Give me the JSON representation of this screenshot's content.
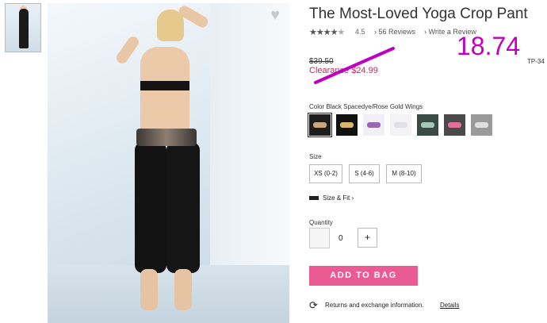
{
  "product": {
    "title": "The Most-Loved Yoga Crop Pant",
    "rating_value": "4.5",
    "reviews_label": "56 Reviews",
    "write_review_label": "Write a Review",
    "original_price": "$39.50",
    "clearance_price": "Clearance $24.99",
    "sku": "TP-34"
  },
  "annotation": {
    "price_text": "18.74",
    "color": "#c000c0"
  },
  "color": {
    "label": "Color Black Spacedye/Rose Gold Wings",
    "swatches": [
      {
        "name": "black-rose-gold-wings",
        "bg": "#1d1d1d",
        "accent": "#c9a878",
        "selected": true
      },
      {
        "name": "black-gold-stripe",
        "bg": "#111111",
        "accent": "#d8b56a",
        "selected": false
      },
      {
        "name": "white-pink-script",
        "bg": "#f2eef5",
        "accent": "#9b65b4",
        "selected": false
      },
      {
        "name": "white",
        "bg": "#f3f3f5",
        "accent": "#e0e0e6",
        "selected": false
      },
      {
        "name": "green-floral",
        "bg": "#3b4a44",
        "accent": "#a7c8b6",
        "selected": false
      },
      {
        "name": "charcoal-pink-wings",
        "bg": "#4a4a4a",
        "accent": "#e0709a",
        "selected": false
      },
      {
        "name": "grey-zebra",
        "bg": "#9a9a9a",
        "accent": "#dedede",
        "selected": false
      }
    ]
  },
  "size": {
    "label": "Size",
    "options": [
      "XS (0-2)",
      "S (4-6)",
      "M (8-10)"
    ],
    "fit_label": "Size & Fit"
  },
  "quantity": {
    "label": "Quantity",
    "value": "0",
    "plus_label": "+"
  },
  "actions": {
    "add_to_bag": "ADD TO BAG",
    "returns_text": "Returns and exchange information.",
    "details_link": "Details"
  },
  "icons": {
    "wishlist": "heart-icon",
    "fit": "ruler-icon",
    "returns": "refresh-icon"
  }
}
